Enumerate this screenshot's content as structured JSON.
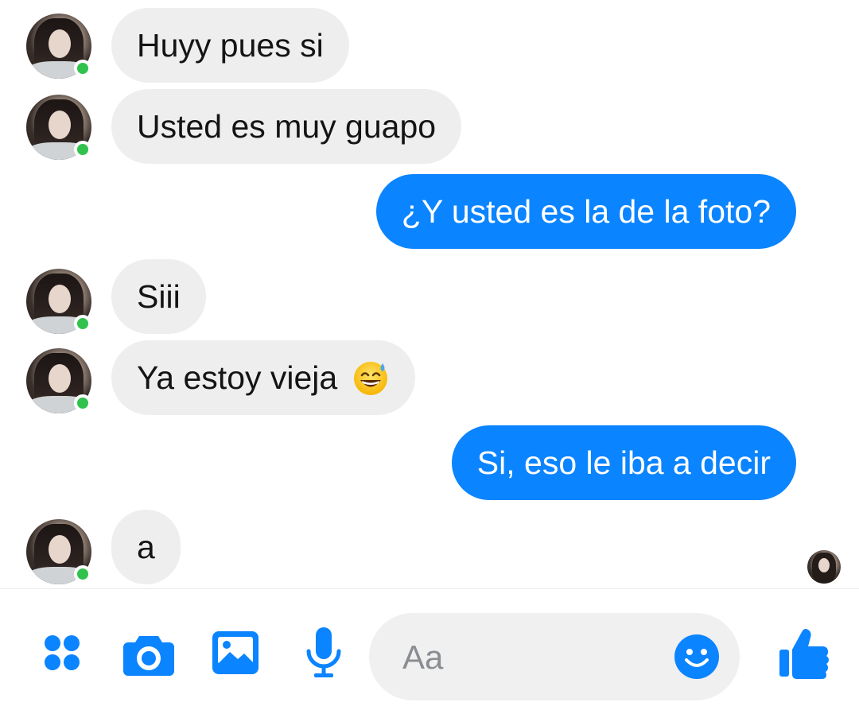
{
  "thread": {
    "messages": [
      {
        "side": "in",
        "text": "Huyy pues si",
        "show_avatar": true,
        "online": true
      },
      {
        "side": "in",
        "text": "Usted es muy guapo",
        "show_avatar": true,
        "online": true
      },
      {
        "side": "out",
        "text": "¿Y usted es la de la foto?"
      },
      {
        "side": "in",
        "text": "Siii",
        "show_avatar": true,
        "online": true
      },
      {
        "side": "in",
        "text": "Ya estoy vieja",
        "emoji": "grinning-face-with-sweat",
        "show_avatar": true,
        "online": true
      },
      {
        "side": "out",
        "text": "Si, eso le iba a decir"
      },
      {
        "side": "in",
        "text": "a",
        "show_avatar": true,
        "online": true
      }
    ]
  },
  "composer": {
    "placeholder": "Aa",
    "icons": [
      "menu-dots-icon",
      "camera-icon",
      "gallery-icon",
      "microphone-icon",
      "emoji-icon",
      "thumbs-up-icon"
    ]
  },
  "colors": {
    "accent": "#0b84ff",
    "incoming_bubble": "#eeeeee",
    "online": "#31c24d"
  }
}
